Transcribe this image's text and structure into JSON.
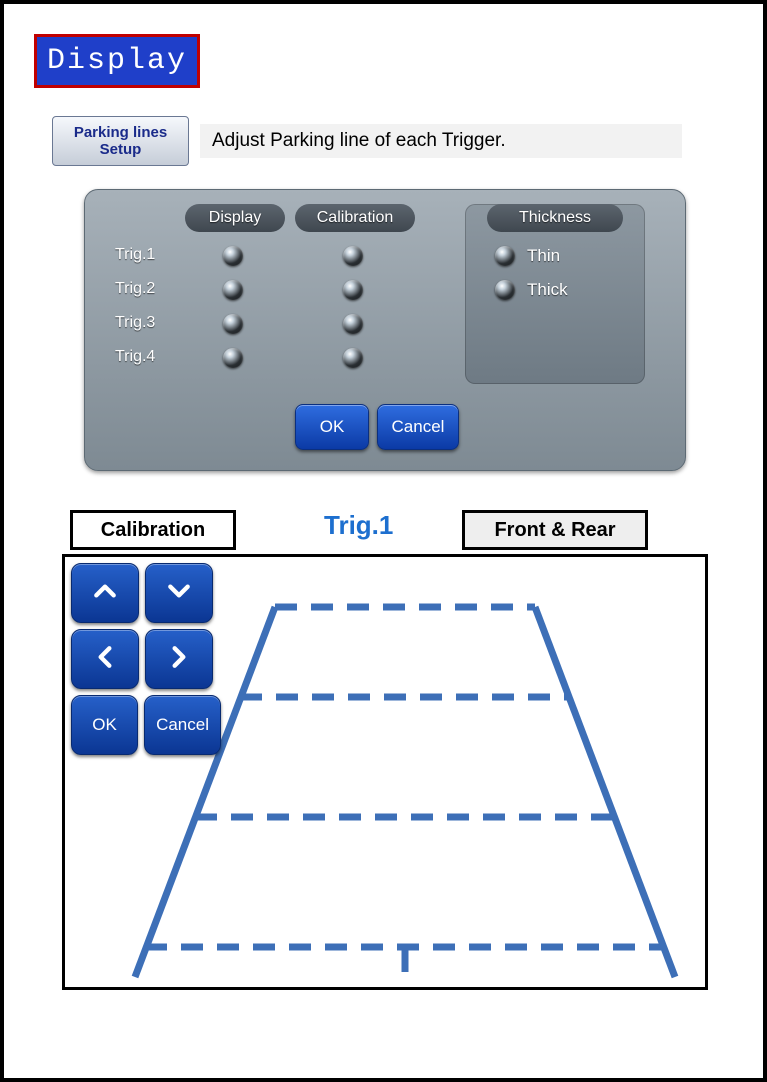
{
  "header": {
    "display_badge": "Display"
  },
  "parking": {
    "button_line1": "Parking lines",
    "button_line2": "Setup",
    "description": "Adjust Parking line of each Trigger."
  },
  "panel": {
    "col_display": "Display",
    "col_calibration": "Calibration",
    "col_thickness": "Thickness",
    "triggers": [
      "Trig.1",
      "Trig.2",
      "Trig.3",
      "Trig.4"
    ],
    "thickness_options": [
      "Thin",
      "Thick"
    ],
    "ok_label": "OK",
    "cancel_label": "Cancel"
  },
  "calibration_section": {
    "label": "Calibration",
    "current_trigger": "Trig.1",
    "front_rear_label": "Front & Rear",
    "pad": {
      "ok": "OK",
      "cancel": "Cancel"
    }
  },
  "colors": {
    "accent_blue": "#1f3fc9",
    "guide_blue": "#3d6fb7"
  }
}
